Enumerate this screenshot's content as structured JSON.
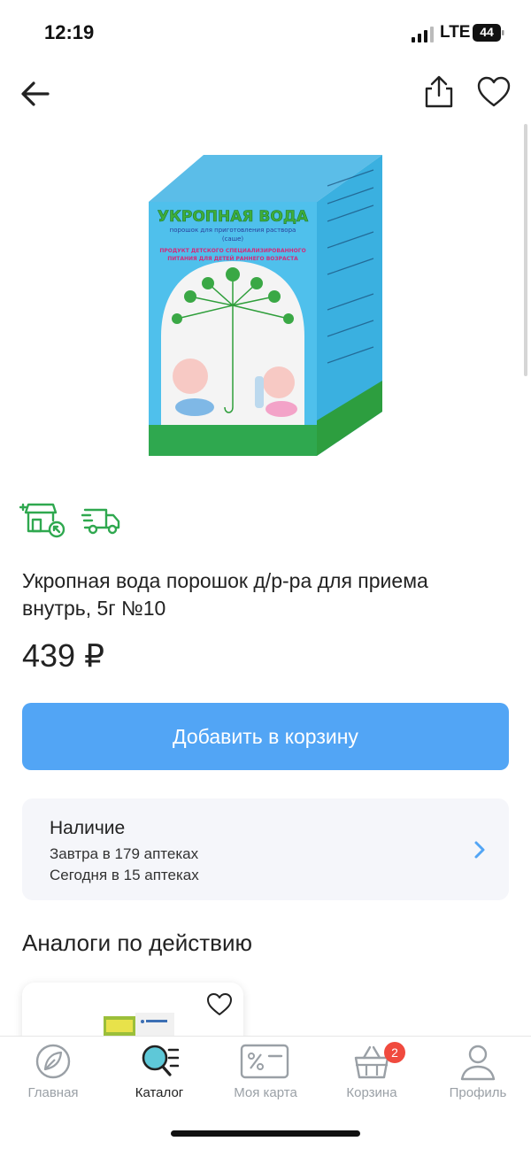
{
  "status_bar": {
    "time": "12:19",
    "network": "LTE",
    "battery": "44"
  },
  "header": {
    "back_icon": "arrow-left-icon",
    "share_icon": "share-icon",
    "favorite_icon": "heart-icon"
  },
  "product": {
    "package_text": {
      "name": "УКРОПНАЯ ВОДА",
      "subtitle": "порошок для приготовления раствора",
      "form": "(саше)",
      "claim_line1": "ПРОДУКТ ДЕТСКОГО СПЕЦИАЛИЗИРОВАННОГО",
      "claim_line2": "ПИТАНИЯ ДЛЯ ДЕТЕЙ РАННЕГО ВОЗРАСТА"
    },
    "title": "Укропная вода порошок д/р-ра для приема внутрь, 5г №10",
    "price": "439 ₽",
    "add_to_cart_label": "Добавить в корзину",
    "colors": {
      "accent": "#52a5f5",
      "green": "#2fa84f"
    }
  },
  "availability": {
    "title": "Наличие",
    "line1": "Завтра в 179 аптеках",
    "line2": "Сегодня в 15 аптеках"
  },
  "analogs": {
    "title": "Аналоги по действию"
  },
  "tabbar": {
    "items": [
      {
        "label": "Главная",
        "icon": "leaf-icon"
      },
      {
        "label": "Каталог",
        "icon": "catalog-search-icon"
      },
      {
        "label": "Моя карта",
        "icon": "discount-card-icon"
      },
      {
        "label": "Корзина",
        "icon": "basket-icon",
        "badge": "2"
      },
      {
        "label": "Профиль",
        "icon": "user-icon"
      }
    ],
    "active": "Каталог"
  }
}
